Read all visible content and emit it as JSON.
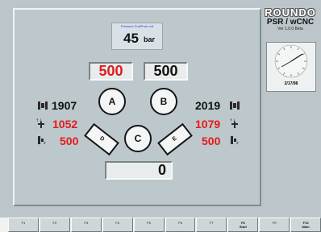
{
  "brand": {
    "logo": "ROUNDO",
    "product": "PSR / wCNC",
    "version": "Ver 1.0.0 Beta"
  },
  "clock": {
    "date": "2/17/98"
  },
  "pressure": {
    "label": "Pressure Pull/Push roll",
    "value": "45",
    "unit": "bar"
  },
  "boxes": {
    "a_value": "500",
    "b_value": "500",
    "total_value": "0"
  },
  "rolls": {
    "a": "A",
    "b": "B",
    "c": "C",
    "d": "D",
    "e": "E"
  },
  "left_values": [
    "1907",
    "1052",
    "500"
  ],
  "right_values": [
    "2019",
    "1079",
    "500"
  ],
  "function_keys": [
    {
      "label": "F1"
    },
    {
      "label": "F2"
    },
    {
      "label": "F3"
    },
    {
      "label": "F4"
    },
    {
      "label": "F5"
    },
    {
      "label": "F6"
    },
    {
      "label": "F7"
    },
    {
      "label": "F8",
      "sub": "Start"
    },
    {
      "label": "F9"
    },
    {
      "label": "F10",
      "sub": "Main"
    }
  ],
  "colors": {
    "red": "#e21b1b",
    "panel": "#bdc8cc",
    "accent_blue": "#223dcc"
  },
  "icons": [
    "roll-sensor-icon",
    "diameter-icon",
    "position-icon"
  ]
}
